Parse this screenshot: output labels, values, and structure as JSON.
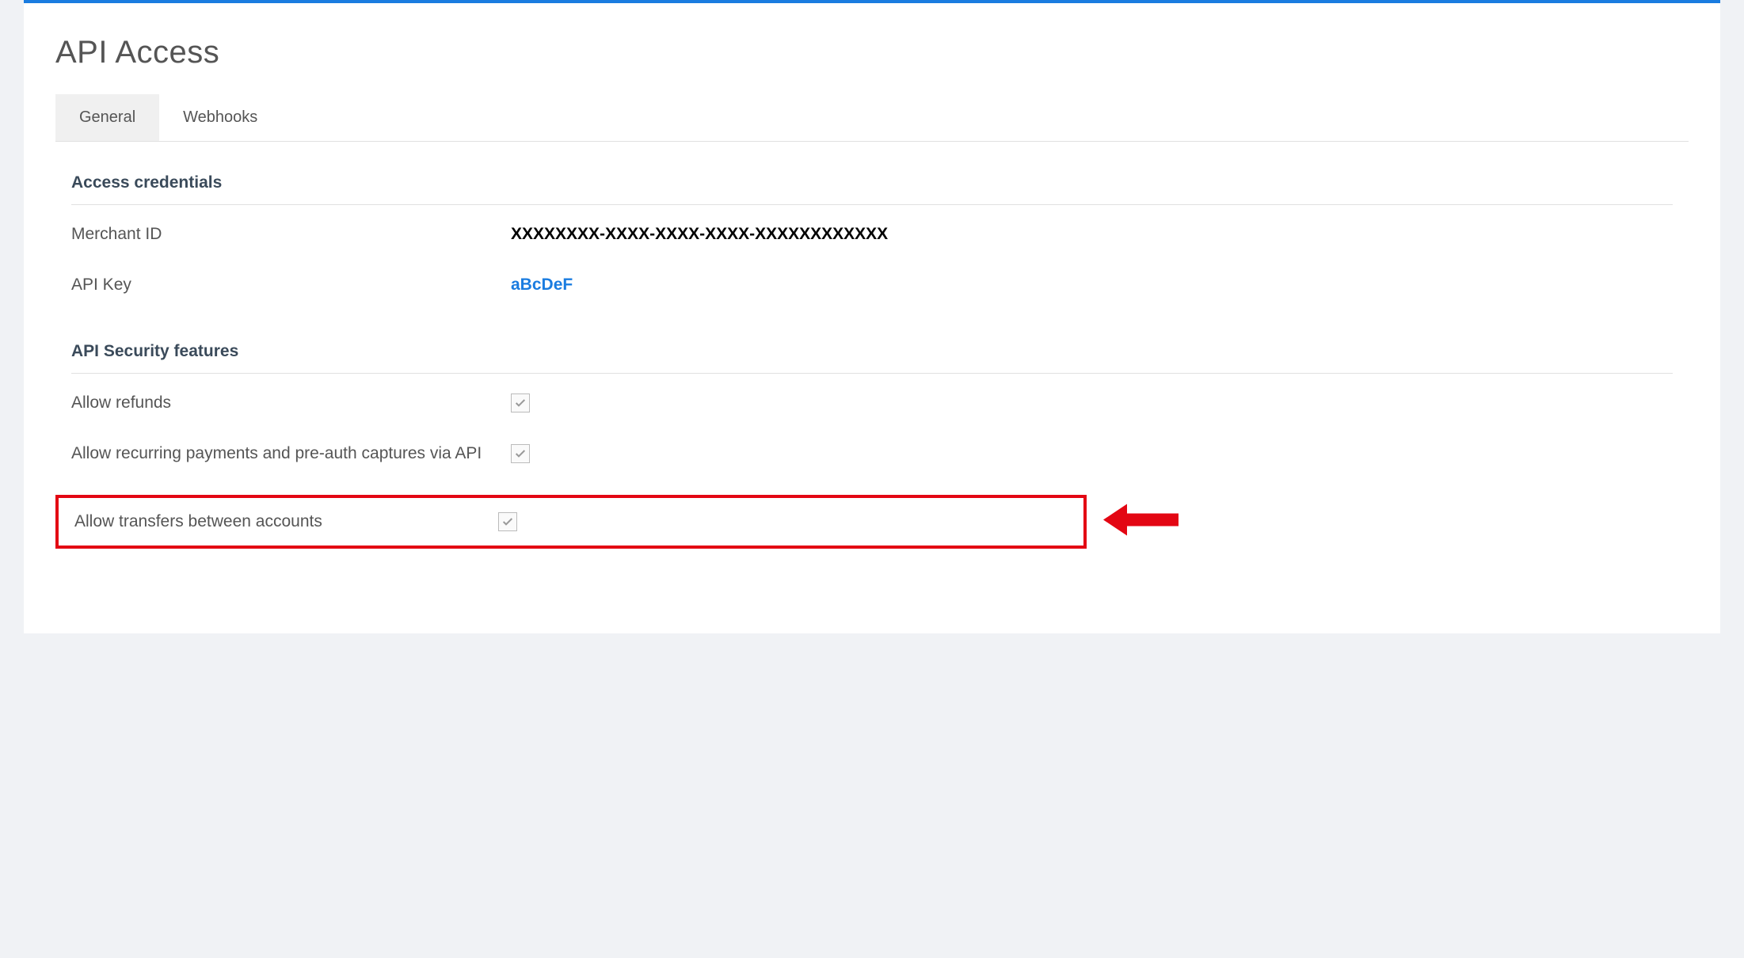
{
  "page": {
    "title": "API Access"
  },
  "tabs": [
    {
      "label": "General",
      "active": true
    },
    {
      "label": "Webhooks",
      "active": false
    }
  ],
  "sections": {
    "credentials": {
      "heading": "Access credentials",
      "fields": {
        "merchant_id": {
          "label": "Merchant ID",
          "value": "XXXXXXXX-XXXX-XXXX-XXXX-XXXXXXXXXXXX"
        },
        "api_key": {
          "label": "API Key",
          "value": "aBcDeF"
        }
      }
    },
    "security": {
      "heading": "API Security features",
      "features": {
        "allow_refunds": {
          "label": "Allow refunds",
          "checked": true
        },
        "allow_recurring": {
          "label": "Allow recurring payments and pre-auth captures via API",
          "checked": true
        },
        "allow_transfers": {
          "label": "Allow transfers between accounts",
          "checked": true
        }
      }
    }
  },
  "annotation": {
    "highlight_color": "#e30613"
  }
}
